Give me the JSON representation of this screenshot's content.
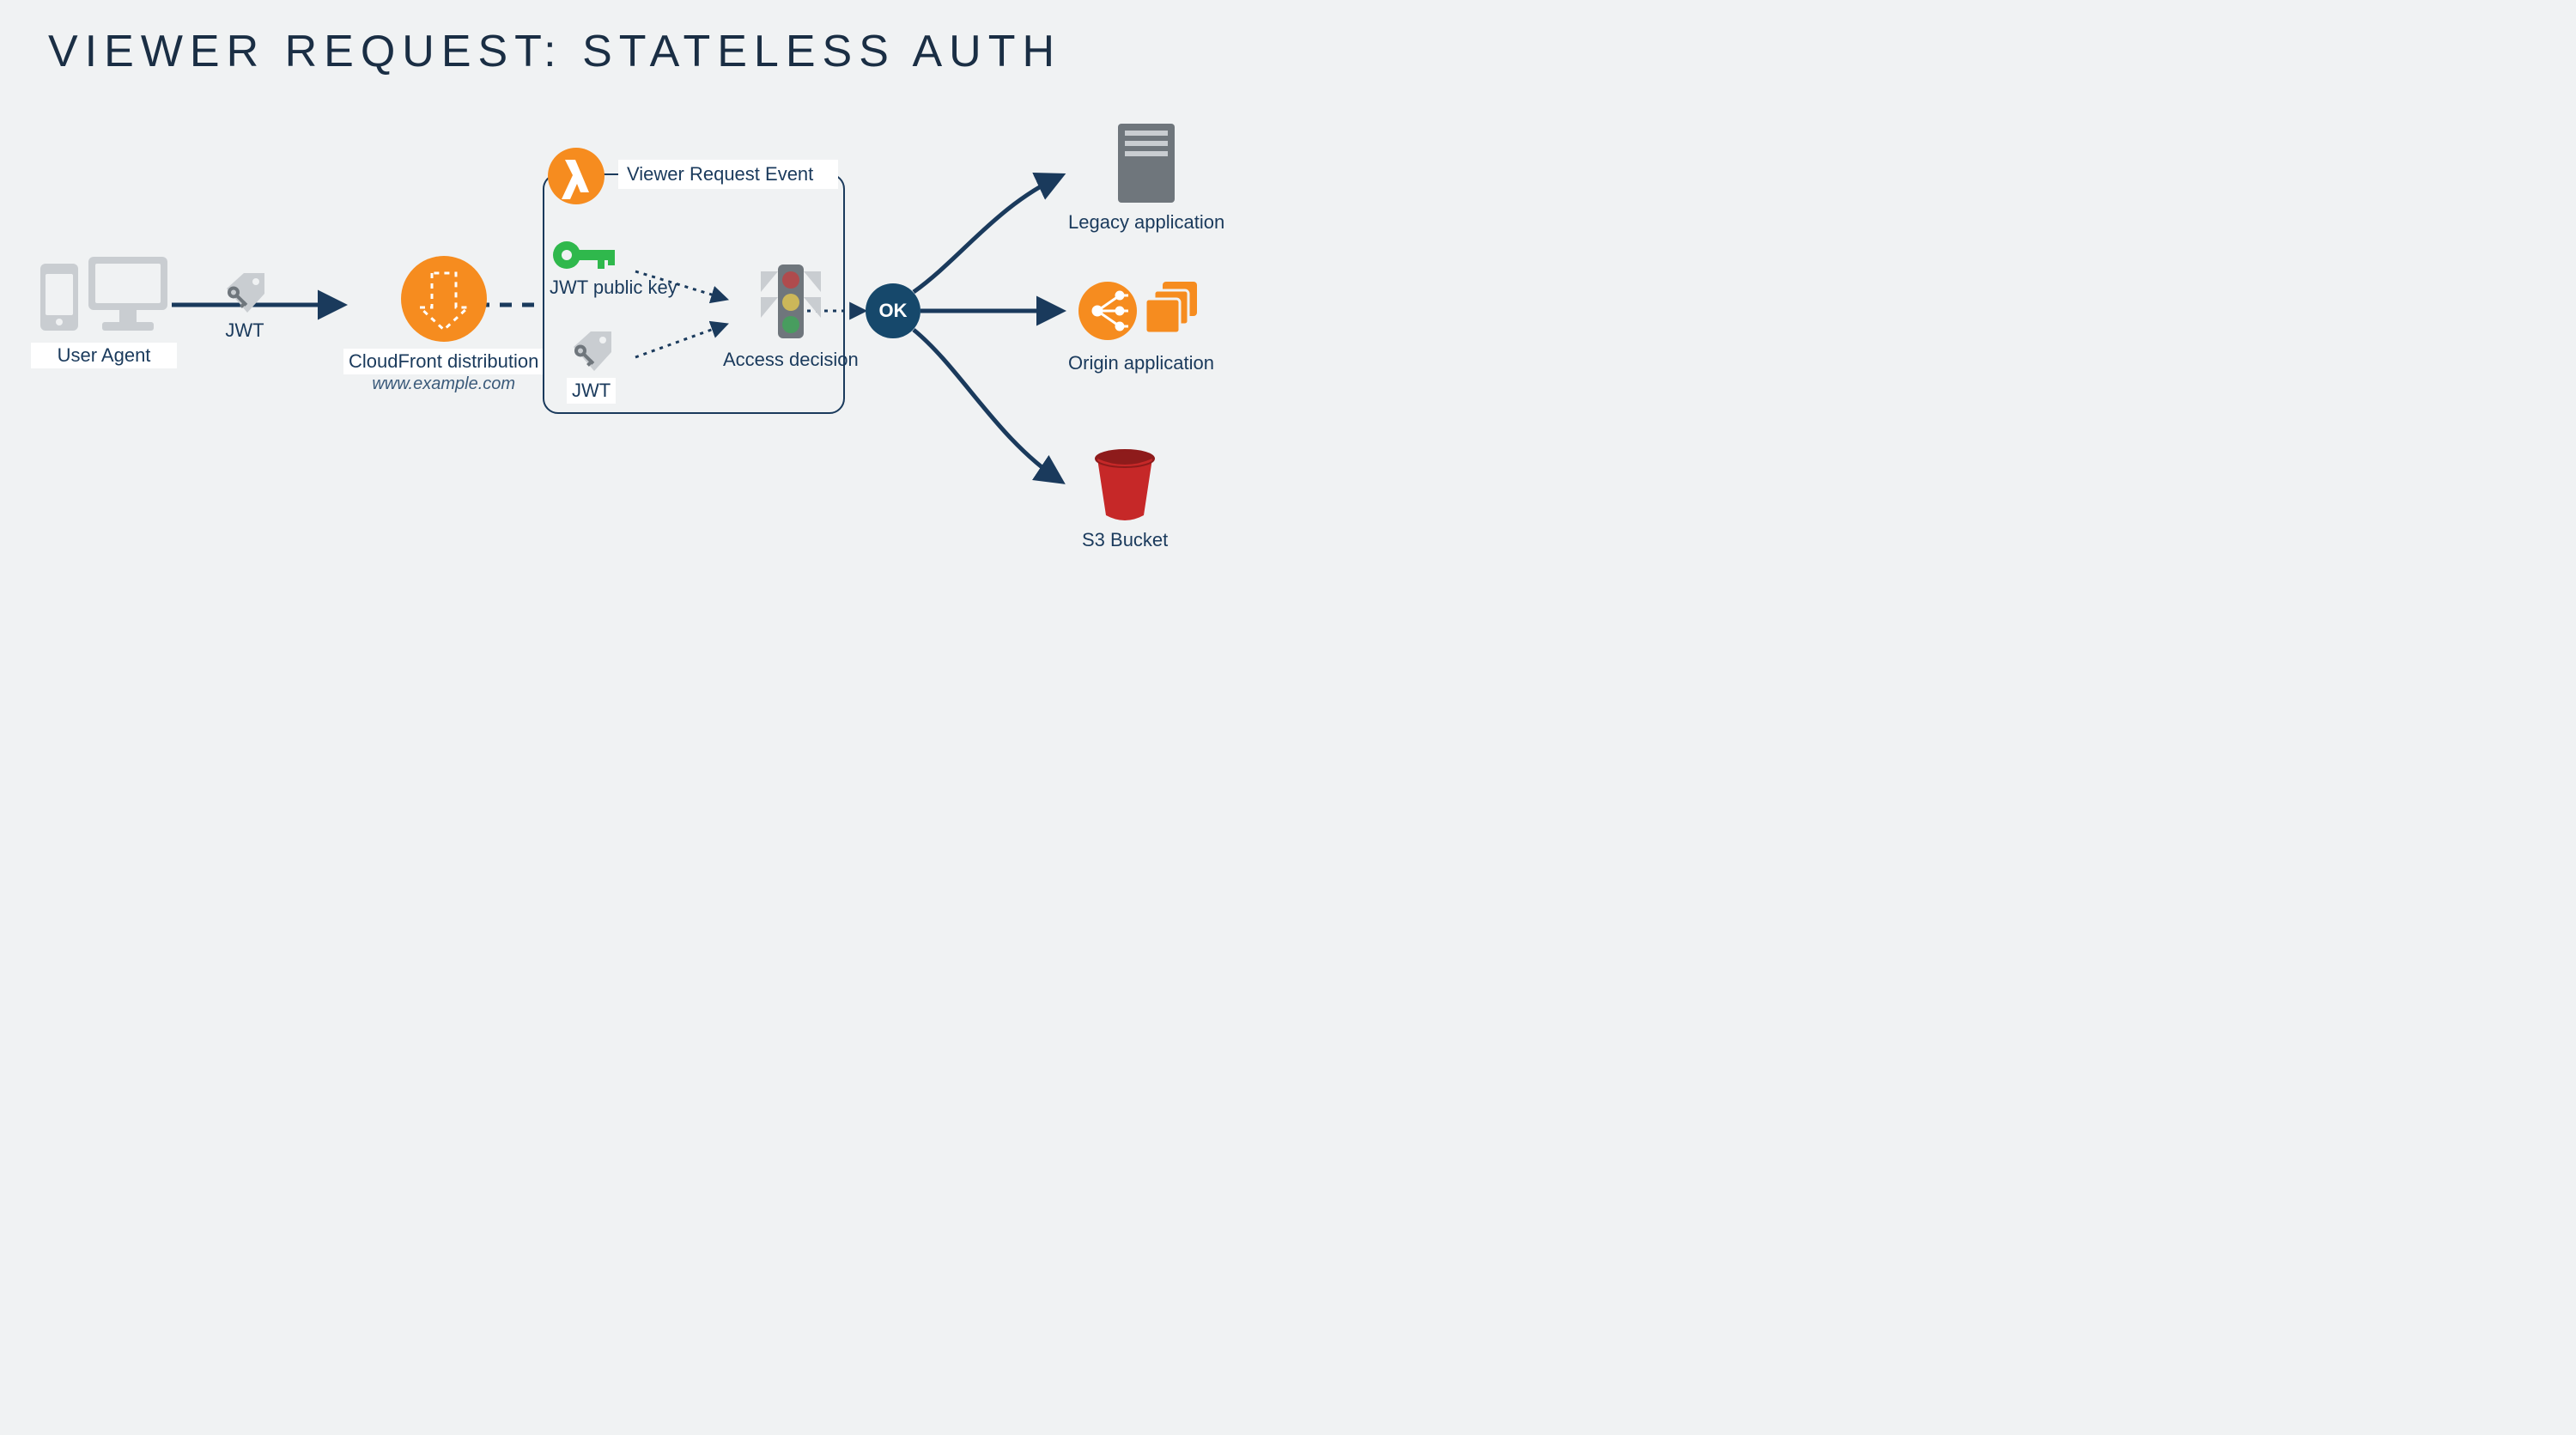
{
  "title": "VIEWER REQUEST: STATELESS AUTH",
  "labels": {
    "user_agent": "User Agent",
    "jwt1": "JWT",
    "cloudfront": "CloudFront distribution",
    "cloudfront_domain": "www.example.com",
    "event_box": "Viewer Request Event",
    "public_key": "JWT public key",
    "jwt2": "JWT",
    "access_decision": "Access decision",
    "ok": "OK",
    "legacy": "Legacy application",
    "origin_app": "Origin application",
    "s3": "S3 Bucket"
  },
  "colors": {
    "text": "#1a3a5c",
    "orange": "#f68c1f",
    "green": "#2fb84c",
    "red": "#d13434",
    "yellow": "#f3d34a",
    "grey": "#9aa3ab",
    "dark_grey": "#6f767c",
    "ok_bg": "#16486b",
    "bucket": "#c62828"
  }
}
